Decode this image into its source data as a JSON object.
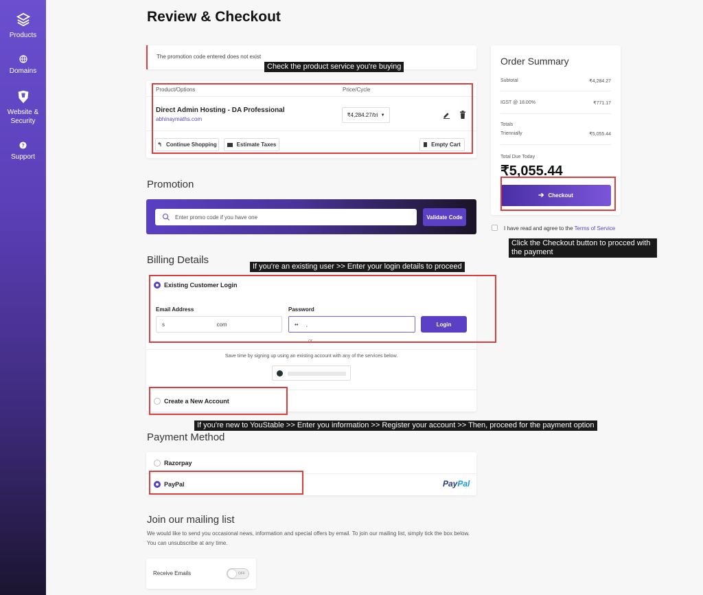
{
  "sidebar": {
    "items": [
      {
        "label": "Products",
        "icon": "cube-icon"
      },
      {
        "label": "Domains",
        "icon": "globe-icon"
      },
      {
        "label": "Website & Security",
        "icon": "shield-icon"
      },
      {
        "label": "Support",
        "icon": "help-icon"
      }
    ]
  },
  "page": {
    "title": "Review & Checkout"
  },
  "alert": {
    "text": "The promotion code entered does not exist"
  },
  "cart": {
    "col_product": "Product/Options",
    "col_price": "Price/Cycle",
    "product_name": "Direct Admin Hosting - DA Professional",
    "product_domain": "abhinaymaths.com",
    "price_select": "₹4,284.27/tri",
    "continue_label": "Continue Shopping",
    "estimate_label": "Estimate Taxes",
    "empty_label": "Empty Cart"
  },
  "promotion": {
    "heading": "Promotion",
    "placeholder": "Enter promo code if you have one",
    "validate_label": "Validate Code"
  },
  "billing": {
    "heading": "Billing Details",
    "existing_label": "Existing Customer Login",
    "email_label": "Email Address",
    "email_value": "s                                  com",
    "password_label": "Password",
    "password_value": "••     ,",
    "login_label": "Login",
    "or_text": "or",
    "signup_text": "Save time by signing up using an existing account with any of the services below.",
    "new_account_label": "Create a New Account"
  },
  "payment": {
    "heading": "Payment Method",
    "option1": "Razorpay",
    "option2": "PayPal",
    "paypal_logo_a": "Pay",
    "paypal_logo_b": "Pal"
  },
  "mailing": {
    "heading": "Join our mailing list",
    "text": "We would like to send you occasional news, information and special offers by email. To join our mailing list, simply tick the box below. You can unsubscribe at any time.",
    "toggle_label": "Receive Emails",
    "toggle_state": "OFF"
  },
  "summary": {
    "title": "Order Summary",
    "subtotal_label": "Subtotal",
    "subtotal_value": "₹4,284.27",
    "tax_label": "IGST @ 18.00%",
    "tax_value": "₹771.17",
    "totals_label": "Totals",
    "cycle_label": "Triennially",
    "cycle_value": "₹5,055.44",
    "due_label": "Total Due Today",
    "due_value": "₹5,055.44",
    "checkout_label": "Checkout",
    "tos_text": "I have read and agree to the",
    "tos_link": "Terms of Service"
  },
  "annotations": {
    "cart_note": "Check the product service you're buying",
    "checkout_note_1": "Click the Checkout button to procced with",
    "checkout_note_2": "the payment",
    "login_note": "If you're an existing user >> Enter your login details to proceed",
    "register_note": "If you're new to YouStable >> Enter you information >> Register your account >> Then, proceed for the payment option"
  },
  "colors": {
    "accent": "#5b3fc4",
    "annotation_border": "#e23b3b",
    "paypal_dark": "#253b80",
    "paypal_light": "#179bd7"
  }
}
